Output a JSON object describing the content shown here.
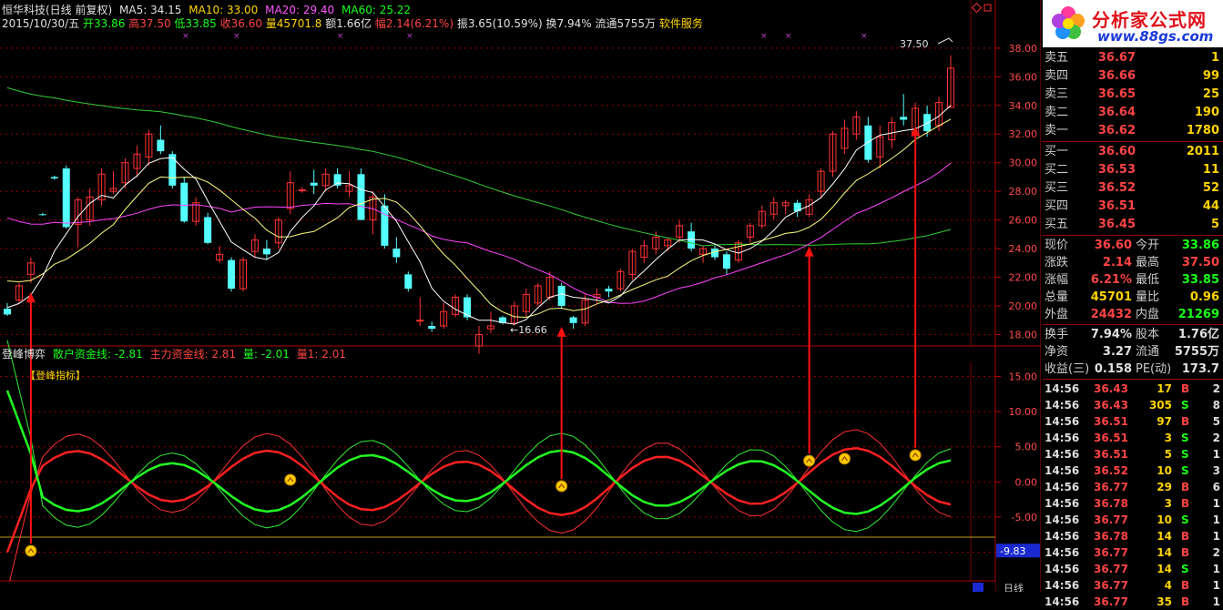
{
  "header": {
    "stock_name": "恒华科技(日线 前复权)",
    "ma5": "MA5: 34.15",
    "ma10": "MA10: 33.00",
    "ma20": "MA20: 29.40",
    "ma60": "MA60: 25.22",
    "date": "2015/10/30/五",
    "open": "开33.86",
    "high": "高37.50",
    "low": "低33.85",
    "close": "收36.60",
    "volume": "量45701.8",
    "amount": "额1.66亿",
    "change": "幅2.14(6.21%)",
    "amplitude": "振3.65(10.59%)",
    "turnover": "换7.94%",
    "float": "流通5755万",
    "industry": "软件服务"
  },
  "main_chart": {
    "y_ticks": [
      "38.00",
      "36.00",
      "34.00",
      "32.00",
      "30.00",
      "28.00",
      "26.00",
      "24.00",
      "22.00",
      "20.00",
      "18.00"
    ],
    "y_range": [
      17.2,
      39.2
    ],
    "high_label": "37.50",
    "low_label": "←16.66",
    "colors": {
      "up": "#ff3232",
      "down": "#54ffff",
      "ma5": "#ffffff",
      "ma10": "#ffff80",
      "ma20": "#ff44ff",
      "ma60": "#33cc33",
      "grid": "#990000"
    }
  },
  "candles": [
    {
      "o": 19.8,
      "h": 20.2,
      "l": 19.3,
      "c": 19.4,
      "up": false
    },
    {
      "o": 20.4,
      "h": 21.6,
      "l": 20.2,
      "c": 21.4,
      "up": true
    },
    {
      "o": 22.2,
      "h": 23.4,
      "l": 21.6,
      "c": 23.0,
      "up": true
    },
    {
      "o": 26.4,
      "h": 26.5,
      "l": 26.3,
      "c": 26.4,
      "up": false
    },
    {
      "o": 29.0,
      "h": 29.1,
      "l": 28.8,
      "c": 28.9,
      "up": false
    },
    {
      "o": 29.6,
      "h": 29.8,
      "l": 25.4,
      "c": 25.5,
      "up": false
    },
    {
      "o": 25.7,
      "h": 27.6,
      "l": 24.1,
      "c": 27.4,
      "up": true
    },
    {
      "o": 26.0,
      "h": 28.2,
      "l": 25.6,
      "c": 27.6,
      "up": true
    },
    {
      "o": 27.4,
      "h": 29.6,
      "l": 27.0,
      "c": 29.2,
      "up": true
    },
    {
      "o": 28.2,
      "h": 29.4,
      "l": 27.8,
      "c": 28.0,
      "up": true
    },
    {
      "o": 28.6,
      "h": 30.3,
      "l": 28.2,
      "c": 30.0,
      "up": true
    },
    {
      "o": 29.6,
      "h": 31.2,
      "l": 29.0,
      "c": 30.6,
      "up": true
    },
    {
      "o": 30.4,
      "h": 32.3,
      "l": 29.8,
      "c": 32.0,
      "up": true
    },
    {
      "o": 31.6,
      "h": 32.6,
      "l": 30.6,
      "c": 30.8,
      "up": false
    },
    {
      "o": 30.6,
      "h": 30.8,
      "l": 28.2,
      "c": 28.4,
      "up": false
    },
    {
      "o": 28.6,
      "h": 29.0,
      "l": 25.8,
      "c": 25.9,
      "up": false
    },
    {
      "o": 25.9,
      "h": 27.6,
      "l": 25.6,
      "c": 27.2,
      "up": true
    },
    {
      "o": 26.2,
      "h": 26.5,
      "l": 24.3,
      "c": 24.4,
      "up": false
    },
    {
      "o": 23.2,
      "h": 24.2,
      "l": 23.0,
      "c": 23.6,
      "up": true
    },
    {
      "o": 23.2,
      "h": 23.4,
      "l": 21.0,
      "c": 21.2,
      "up": false
    },
    {
      "o": 21.2,
      "h": 23.4,
      "l": 21.0,
      "c": 23.2,
      "up": true
    },
    {
      "o": 23.8,
      "h": 25.0,
      "l": 23.4,
      "c": 24.6,
      "up": true
    },
    {
      "o": 24.0,
      "h": 24.6,
      "l": 23.2,
      "c": 23.6,
      "up": false
    },
    {
      "o": 24.4,
      "h": 26.2,
      "l": 24.0,
      "c": 26.0,
      "up": true
    },
    {
      "o": 26.8,
      "h": 29.4,
      "l": 26.4,
      "c": 28.6,
      "up": true
    },
    {
      "o": 28.1,
      "h": 28.3,
      "l": 27.9,
      "c": 28.1,
      "up": true
    },
    {
      "o": 28.4,
      "h": 29.5,
      "l": 27.8,
      "c": 28.6,
      "up": false
    },
    {
      "o": 28.4,
      "h": 29.6,
      "l": 28.0,
      "c": 29.2,
      "up": true
    },
    {
      "o": 29.2,
      "h": 29.6,
      "l": 28.2,
      "c": 28.4,
      "up": false
    },
    {
      "o": 28.0,
      "h": 29.4,
      "l": 27.6,
      "c": 28.4,
      "up": true
    },
    {
      "o": 29.2,
      "h": 29.6,
      "l": 26.0,
      "c": 26.0,
      "up": false
    },
    {
      "o": 26.0,
      "h": 28.0,
      "l": 25.0,
      "c": 27.6,
      "up": true
    },
    {
      "o": 27.0,
      "h": 27.8,
      "l": 24.0,
      "c": 24.2,
      "up": false
    },
    {
      "o": 24.0,
      "h": 24.8,
      "l": 23.0,
      "c": 23.4,
      "up": false
    },
    {
      "o": 22.2,
      "h": 22.4,
      "l": 21.0,
      "c": 21.2,
      "up": false
    },
    {
      "o": 19.0,
      "h": 20.6,
      "l": 18.6,
      "c": 19.0,
      "up": true
    },
    {
      "o": 18.6,
      "h": 18.9,
      "l": 18.2,
      "c": 18.4,
      "up": false
    },
    {
      "o": 18.6,
      "h": 20.2,
      "l": 18.4,
      "c": 19.6,
      "up": true
    },
    {
      "o": 19.4,
      "h": 20.8,
      "l": 19.2,
      "c": 20.6,
      "up": true
    },
    {
      "o": 20.6,
      "h": 20.8,
      "l": 19.0,
      "c": 19.2,
      "up": false
    },
    {
      "o": 18.0,
      "h": 18.6,
      "l": 16.66,
      "c": 17.2,
      "up": true
    },
    {
      "o": 18.6,
      "h": 19.6,
      "l": 18.1,
      "c": 18.4,
      "up": true
    },
    {
      "o": 19.2,
      "h": 19.3,
      "l": 18.7,
      "c": 18.8,
      "up": false
    },
    {
      "o": 18.8,
      "h": 20.3,
      "l": 18.6,
      "c": 20.0,
      "up": true
    },
    {
      "o": 19.6,
      "h": 21.2,
      "l": 19.2,
      "c": 20.8,
      "up": true
    },
    {
      "o": 20.2,
      "h": 21.6,
      "l": 20.0,
      "c": 21.4,
      "up": true
    },
    {
      "o": 20.6,
      "h": 22.4,
      "l": 20.4,
      "c": 22.0,
      "up": true
    },
    {
      "o": 21.4,
      "h": 21.6,
      "l": 19.8,
      "c": 20.0,
      "up": false
    },
    {
      "o": 19.2,
      "h": 19.3,
      "l": 18.4,
      "c": 18.8,
      "up": false
    },
    {
      "o": 18.8,
      "h": 20.8,
      "l": 18.6,
      "c": 20.4,
      "up": true
    },
    {
      "o": 20.6,
      "h": 21.2,
      "l": 20.2,
      "c": 20.8,
      "up": true
    },
    {
      "o": 21.2,
      "h": 21.4,
      "l": 20.6,
      "c": 21.0,
      "up": false
    },
    {
      "o": 21.2,
      "h": 22.6,
      "l": 21.0,
      "c": 22.4,
      "up": true
    },
    {
      "o": 22.2,
      "h": 24.0,
      "l": 21.8,
      "c": 23.8,
      "up": true
    },
    {
      "o": 23.4,
      "h": 24.6,
      "l": 23.0,
      "c": 24.2,
      "up": true
    },
    {
      "o": 24.0,
      "h": 25.2,
      "l": 23.6,
      "c": 24.8,
      "up": true
    },
    {
      "o": 24.2,
      "h": 24.8,
      "l": 23.8,
      "c": 24.6,
      "up": true
    },
    {
      "o": 24.8,
      "h": 26.0,
      "l": 24.4,
      "c": 25.6,
      "up": true
    },
    {
      "o": 25.2,
      "h": 25.8,
      "l": 23.8,
      "c": 24.0,
      "up": false
    },
    {
      "o": 23.6,
      "h": 24.2,
      "l": 23.0,
      "c": 24.0,
      "up": true
    },
    {
      "o": 24.0,
      "h": 24.2,
      "l": 23.2,
      "c": 23.4,
      "up": false
    },
    {
      "o": 23.6,
      "h": 23.8,
      "l": 22.2,
      "c": 22.6,
      "up": false
    },
    {
      "o": 23.2,
      "h": 24.6,
      "l": 23.0,
      "c": 24.4,
      "up": true
    },
    {
      "o": 24.8,
      "h": 25.8,
      "l": 24.4,
      "c": 25.6,
      "up": true
    },
    {
      "o": 25.6,
      "h": 27.0,
      "l": 25.4,
      "c": 26.6,
      "up": true
    },
    {
      "o": 26.4,
      "h": 27.6,
      "l": 26.0,
      "c": 27.2,
      "up": true
    },
    {
      "o": 27.0,
      "h": 27.4,
      "l": 26.4,
      "c": 27.2,
      "up": true
    },
    {
      "o": 27.2,
      "h": 27.4,
      "l": 26.2,
      "c": 26.6,
      "up": false
    },
    {
      "o": 26.4,
      "h": 27.8,
      "l": 26.2,
      "c": 27.4,
      "up": true
    },
    {
      "o": 28.0,
      "h": 29.6,
      "l": 27.6,
      "c": 29.4,
      "up": true
    },
    {
      "o": 29.4,
      "h": 32.2,
      "l": 29.0,
      "c": 32.0,
      "up": true
    },
    {
      "o": 31.0,
      "h": 33.0,
      "l": 30.6,
      "c": 32.4,
      "up": true
    },
    {
      "o": 32.0,
      "h": 33.6,
      "l": 31.6,
      "c": 33.2,
      "up": true
    },
    {
      "o": 32.6,
      "h": 33.2,
      "l": 30.0,
      "c": 30.2,
      "up": false
    },
    {
      "o": 30.4,
      "h": 32.6,
      "l": 29.6,
      "c": 31.8,
      "up": true
    },
    {
      "o": 31.6,
      "h": 33.2,
      "l": 31.0,
      "c": 32.8,
      "up": true
    },
    {
      "o": 33.0,
      "h": 34.8,
      "l": 32.6,
      "c": 33.2,
      "up": false
    },
    {
      "o": 32.0,
      "h": 34.2,
      "l": 31.4,
      "c": 33.8,
      "up": true
    },
    {
      "o": 33.4,
      "h": 34.0,
      "l": 31.8,
      "c": 32.2,
      "up": false
    },
    {
      "o": 32.6,
      "h": 34.6,
      "l": 32.2,
      "c": 34.2,
      "up": true
    },
    {
      "o": 33.86,
      "h": 37.5,
      "l": 33.85,
      "c": 36.6,
      "up": true
    }
  ],
  "indicator": {
    "title": "登峰博弈",
    "retail_label": "散户资金线: -2.81",
    "main_label": "主力资金线: 2.81",
    "vol_label": "量: -2.01",
    "vol1_label": "量1: 2.01",
    "panel_label": "【登峰指标】",
    "y_ticks": [
      "15.00",
      "10.00",
      "5.00",
      "0.00",
      "-5.00",
      "-10.00"
    ],
    "y_range": [
      -12,
      17
    ],
    "current_value": "-9.83"
  },
  "quotes": {
    "asks": [
      {
        "label": "卖五",
        "price": "36.67",
        "vol": "1"
      },
      {
        "label": "卖四",
        "price": "36.66",
        "vol": "99"
      },
      {
        "label": "卖三",
        "price": "36.65",
        "vol": "25"
      },
      {
        "label": "卖二",
        "price": "36.64",
        "vol": "190"
      },
      {
        "label": "卖一",
        "price": "36.62",
        "vol": "1780"
      }
    ],
    "bids": [
      {
        "label": "买一",
        "price": "36.60",
        "vol": "2011"
      },
      {
        "label": "买二",
        "price": "36.53",
        "vol": "11"
      },
      {
        "label": "买三",
        "price": "36.52",
        "vol": "52"
      },
      {
        "label": "买四",
        "price": "36.51",
        "vol": "44"
      },
      {
        "label": "买五",
        "price": "36.45",
        "vol": "5"
      }
    ],
    "stats": [
      {
        "l1": "现价",
        "v1": "36.60",
        "c1": "red",
        "l2": "今开",
        "v2": "33.86",
        "c2": "green"
      },
      {
        "l1": "涨跌",
        "v1": "2.14",
        "c1": "red",
        "l2": "最高",
        "v2": "37.50",
        "c2": "red"
      },
      {
        "l1": "涨幅",
        "v1": "6.21%",
        "c1": "red",
        "l2": "最低",
        "v2": "33.85",
        "c2": "green"
      },
      {
        "l1": "总量",
        "v1": "45701",
        "c1": "yellow",
        "l2": "量比",
        "v2": "0.96",
        "c2": "yellow"
      },
      {
        "l1": "外盘",
        "v1": "24432",
        "c1": "red",
        "l2": "内盘",
        "v2": "21269",
        "c2": "green"
      },
      {
        "l1": "换手",
        "v1": "7.94%",
        "c1": "white",
        "l2": "股本",
        "v2": "1.76亿",
        "c2": "white"
      },
      {
        "l1": "净资",
        "v1": "3.27",
        "c1": "white",
        "l2": "流通",
        "v2": "5755万",
        "c2": "white"
      },
      {
        "l1": "收益(三)",
        "v1": "0.158",
        "c1": "white",
        "l2": "PE(动)",
        "v2": "173.7",
        "c2": "white"
      }
    ],
    "ticks": [
      {
        "t": "14:56",
        "p": "36.43",
        "v": "17",
        "bs": "B",
        "n": "2"
      },
      {
        "t": "14:56",
        "p": "36.43",
        "v": "305",
        "bs": "S",
        "n": "8"
      },
      {
        "t": "14:56",
        "p": "36.51",
        "v": "97",
        "bs": "B",
        "n": "5"
      },
      {
        "t": "14:56",
        "p": "36.51",
        "v": "3",
        "bs": "S",
        "n": "2"
      },
      {
        "t": "14:56",
        "p": "36.51",
        "v": "5",
        "bs": "S",
        "n": "1"
      },
      {
        "t": "14:56",
        "p": "36.52",
        "v": "10",
        "bs": "S",
        "n": "3"
      },
      {
        "t": "14:56",
        "p": "36.77",
        "v": "29",
        "bs": "B",
        "n": "6"
      },
      {
        "t": "14:56",
        "p": "36.78",
        "v": "3",
        "bs": "B",
        "n": "1"
      },
      {
        "t": "14:56",
        "p": "36.77",
        "v": "10",
        "bs": "S",
        "n": "1"
      },
      {
        "t": "14:56",
        "p": "36.78",
        "v": "14",
        "bs": "B",
        "n": "1"
      },
      {
        "t": "14:56",
        "p": "36.77",
        "v": "14",
        "bs": "B",
        "n": "2"
      },
      {
        "t": "14:56",
        "p": "36.77",
        "v": "14",
        "bs": "S",
        "n": "1"
      },
      {
        "t": "14:56",
        "p": "36.77",
        "v": "4",
        "bs": "B",
        "n": "1"
      },
      {
        "t": "14:56",
        "p": "36.77",
        "v": "35",
        "bs": "B",
        "n": "1"
      }
    ]
  },
  "logo": {
    "title": "分析家公式网",
    "url": "www.88gs.com"
  },
  "bottom": {
    "tab_label": "日线"
  }
}
